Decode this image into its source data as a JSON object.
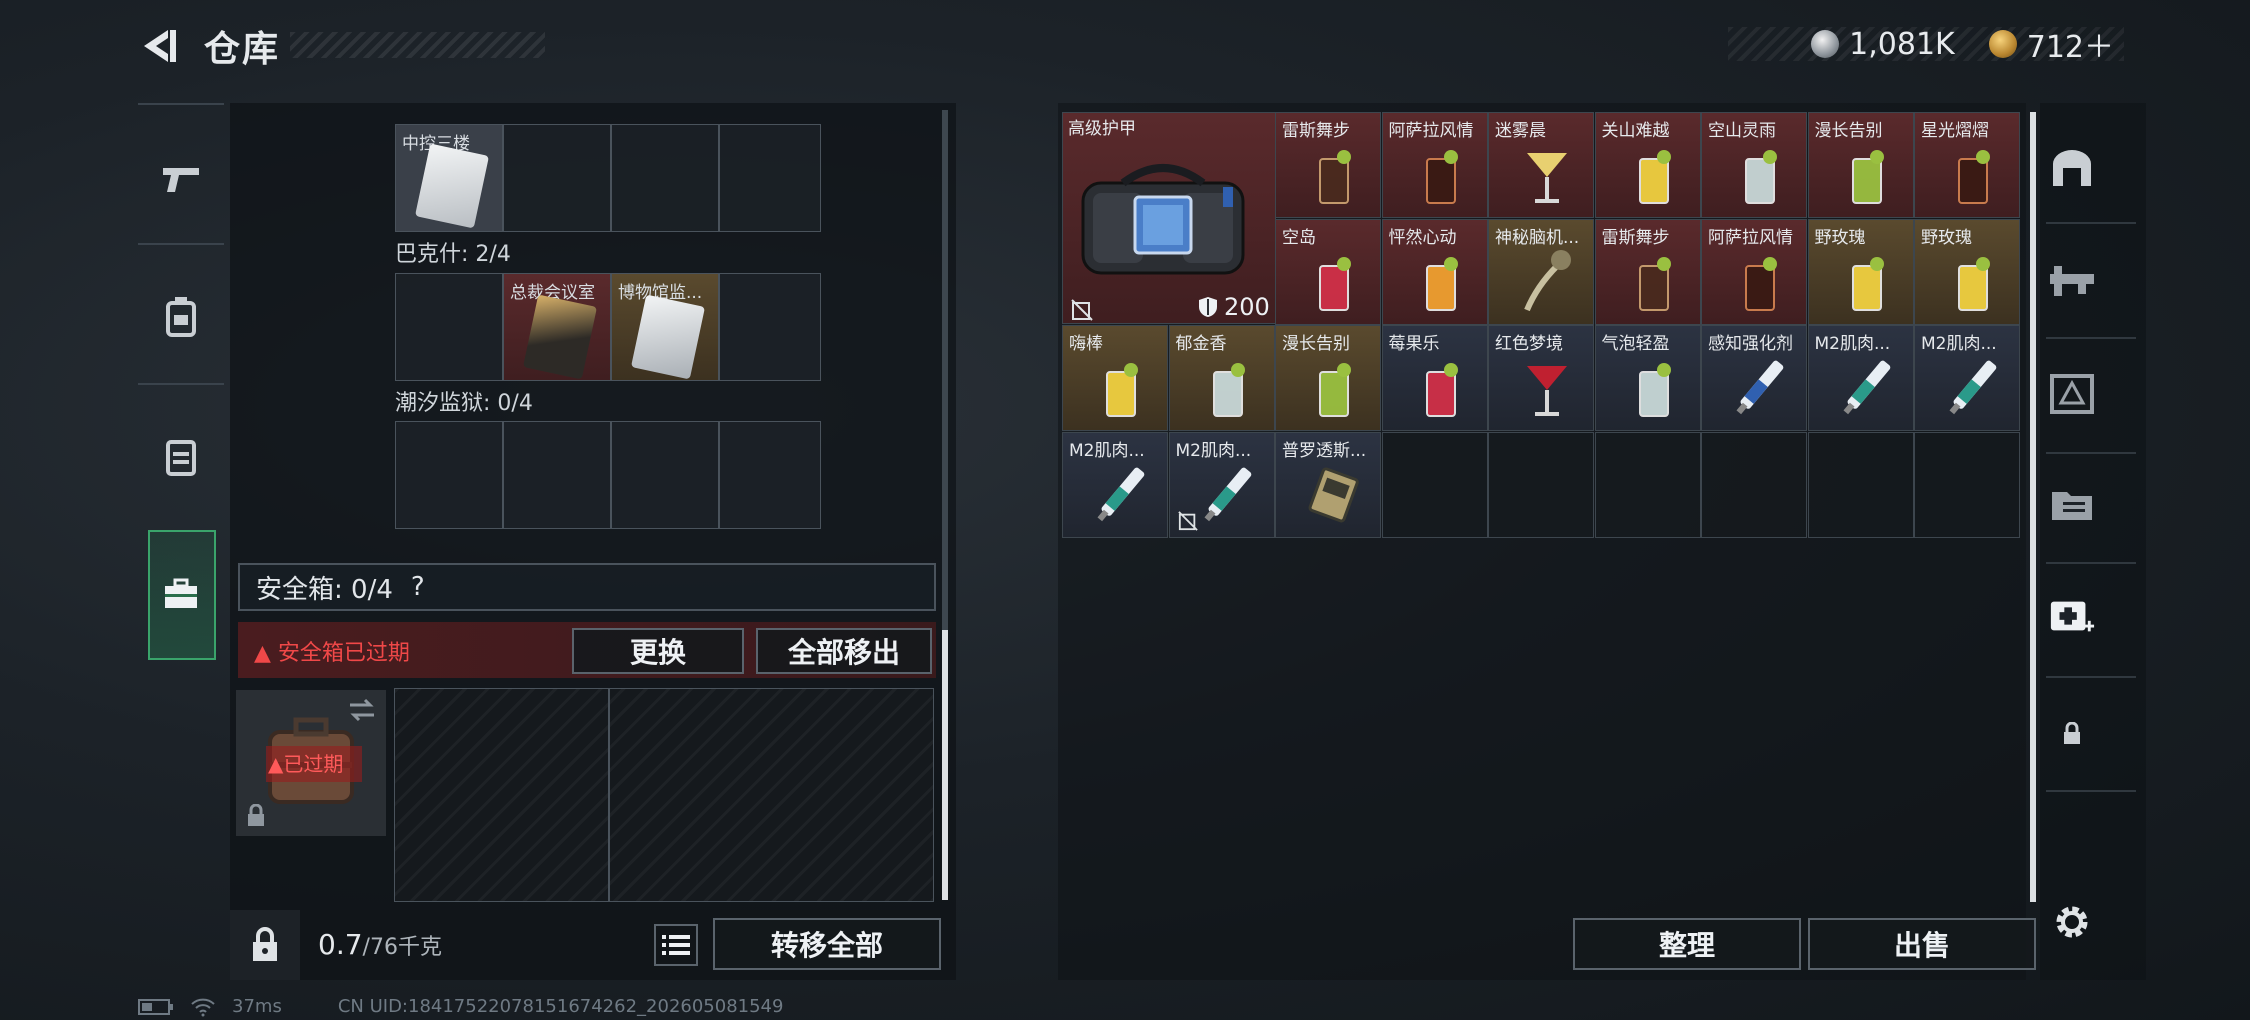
{
  "header": {
    "title": "仓库",
    "currency_silver": "1,081K",
    "currency_gold": "712＋"
  },
  "left_nav": [
    "pistol-icon",
    "backpack-icon",
    "rig-icon",
    "safe-box-icon"
  ],
  "keycard_groups": [
    {
      "label": "",
      "slots": [
        {
          "name": "中控三楼",
          "kind": "card"
        },
        null,
        null,
        null
      ]
    },
    {
      "label": "巴克什: 2/4",
      "slots": [
        null,
        {
          "name": "总裁会议室",
          "kind": "card-gold"
        },
        {
          "name": "博物馆监...",
          "kind": "card"
        },
        null
      ]
    },
    {
      "label": "潮汐监狱: 0/4",
      "slots": [
        null,
        null,
        null,
        null
      ]
    }
  ],
  "safe_box": {
    "label": "安全箱: 0/4",
    "help": "?",
    "expired_text": "安全箱已过期",
    "swap_label": "更换",
    "move_all_label": "全部移出",
    "expired_tag": "已过期"
  },
  "bottom": {
    "weight": "0.7",
    "weight_unit": "/76千克",
    "transfer_label": "转移全部"
  },
  "inventory": {
    "armor": {
      "name": "高级护甲",
      "durability": "200"
    },
    "items": [
      {
        "name": "雷斯舞步",
        "color": "red",
        "art": "cocktail-dark",
        "row": 0,
        "col": 2
      },
      {
        "name": "阿萨拉风情",
        "color": "red",
        "art": "cocktail-tall",
        "row": 0,
        "col": 3
      },
      {
        "name": "迷雾晨",
        "color": "red",
        "art": "cocktail-martini",
        "row": 0,
        "col": 4
      },
      {
        "name": "关山难越",
        "color": "red",
        "art": "cocktail-yellow",
        "row": 0,
        "col": 5
      },
      {
        "name": "空山灵雨",
        "color": "red",
        "art": "cocktail-clear",
        "row": 0,
        "col": 6
      },
      {
        "name": "漫长告别",
        "color": "red",
        "art": "cocktail-green",
        "row": 0,
        "col": 7
      },
      {
        "name": "星光熠熠",
        "color": "red",
        "art": "cocktail-tall",
        "row": 0,
        "col": 8
      },
      {
        "name": "空岛",
        "color": "red",
        "art": "cocktail-pink",
        "row": 1,
        "col": 2
      },
      {
        "name": "怦然心动",
        "color": "red",
        "art": "cocktail-orange",
        "row": 1,
        "col": 3
      },
      {
        "name": "神秘脑机...",
        "color": "gold",
        "art": "cable",
        "row": 1,
        "col": 4
      },
      {
        "name": "雷斯舞步",
        "color": "red",
        "art": "cocktail-dark",
        "row": 1,
        "col": 5
      },
      {
        "name": "阿萨拉风情",
        "color": "red",
        "art": "cocktail-tall",
        "row": 1,
        "col": 6
      },
      {
        "name": "野玫瑰",
        "color": "gold",
        "art": "cocktail-yellow",
        "row": 1,
        "col": 7
      },
      {
        "name": "野玫瑰",
        "color": "gold",
        "art": "cocktail-yellow",
        "row": 1,
        "col": 8
      },
      {
        "name": "嗨棒",
        "color": "gold",
        "art": "cocktail-yellow",
        "row": 2,
        "col": 0
      },
      {
        "name": "郁金香",
        "color": "gold",
        "art": "cocktail-clear",
        "row": 2,
        "col": 1
      },
      {
        "name": "漫长告别",
        "color": "gold",
        "art": "cocktail-green",
        "row": 2,
        "col": 2
      },
      {
        "name": "莓果乐",
        "color": "blue",
        "art": "cocktail-pink",
        "row": 2,
        "col": 3
      },
      {
        "name": "红色梦境",
        "color": "blue",
        "art": "cocktail-martini-red",
        "row": 2,
        "col": 4
      },
      {
        "name": "气泡轻盈",
        "color": "blue",
        "art": "cocktail-clear",
        "row": 2,
        "col": 5
      },
      {
        "name": "感知强化剂",
        "color": "blue",
        "art": "injector-blue",
        "row": 2,
        "col": 6
      },
      {
        "name": "M2肌肉...",
        "color": "blue",
        "art": "injector-teal",
        "row": 2,
        "col": 7
      },
      {
        "name": "M2肌肉...",
        "color": "blue",
        "art": "injector-teal",
        "row": 2,
        "col": 8
      },
      {
        "name": "M2肌肉...",
        "color": "blue",
        "art": "injector-teal",
        "row": 3,
        "col": 0
      },
      {
        "name": "M2肌肉...",
        "color": "blue",
        "art": "injector-teal",
        "row": 3,
        "col": 1,
        "disabled": true
      },
      {
        "name": "普罗透斯...",
        "color": "blue",
        "art": "device",
        "row": 3,
        "col": 2
      }
    ],
    "sort_label": "整理",
    "sell_label": "出售"
  },
  "right_nav": [
    "armor-icon",
    "rifle-icon",
    "ammo-icon",
    "folder-icon",
    "medkit-add-icon",
    "lock-icon",
    "settings-icon"
  ],
  "footer": {
    "ping": "37ms",
    "uid": "CN UID:18417522078151674262_202605081549"
  }
}
